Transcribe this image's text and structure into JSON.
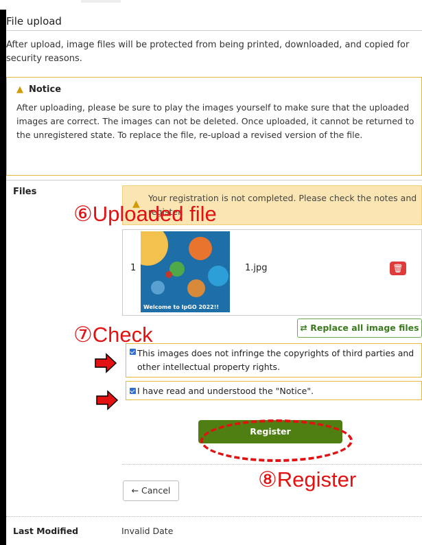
{
  "page": {
    "title": "File upload",
    "description": "After upload, image files will be protected from being printed, downloaded, and copied for security reasons."
  },
  "notice": {
    "heading": "Notice",
    "body": "After uploading, please be sure to play the images yourself to make sure that the uploaded images are correct. The images can not be deleted. Once uploaded, it cannot be returned to the unregistered state. To replace the file, re-upload a revised version of the file."
  },
  "files": {
    "label": "Files",
    "alert": "Your registration is not completed. Please check the notes and register.",
    "items": [
      {
        "index": "1",
        "name": "1.jpg",
        "thumb_caption": "Welcome to IpGO 2022!!"
      }
    ],
    "replace_label": "⇄ Replace all image files"
  },
  "checks": {
    "copyright": "This images does not infringe the copyrights of third parties and other intellectual property rights.",
    "notice_read": "I have read and understood the \"Notice\"."
  },
  "actions": {
    "register": "Register",
    "cancel": "← Cancel"
  },
  "meta": {
    "last_modified_label": "Last Modified",
    "last_modified_value": "Invalid Date"
  },
  "annotations": {
    "step6": "⑥Uploaded file",
    "step7": "⑦Check",
    "step8": "⑧Register"
  },
  "colors": {
    "register": "#4f7e12",
    "annotation": "#e21212",
    "notice_border": "#e4b83c",
    "alert_bg": "#fbe6b3"
  }
}
